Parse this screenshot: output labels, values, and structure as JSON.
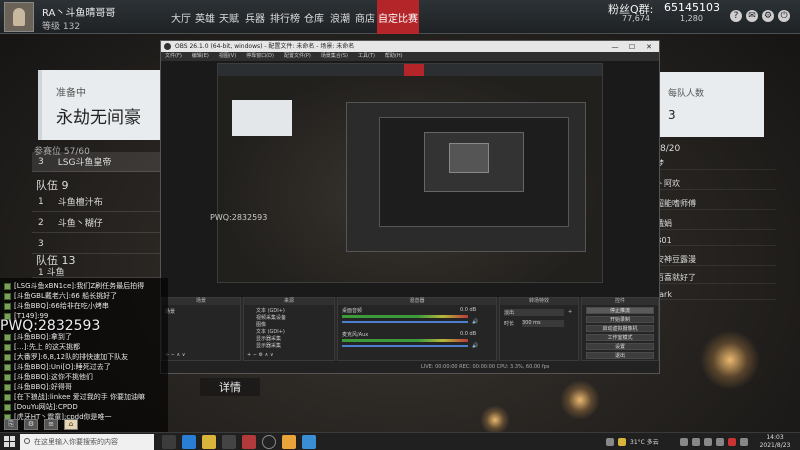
{
  "game": {
    "player_name": "RA丶斗鱼晴哥哥",
    "player_level": "等级 132",
    "nav": [
      "大厅",
      "英雄",
      "天赋",
      "兵器",
      "排行榜",
      "仓库",
      "浪潮",
      "商店",
      "自定比赛"
    ],
    "fans_label": "粉丝Q群:",
    "fans_group": "65145103",
    "coins_a": "77,674",
    "coins_b": "1,280"
  },
  "lobby": {
    "status": "准备中",
    "name": "永劫无间豪",
    "per_team_label": "每队人数",
    "per_team_value": "3",
    "seats_label": "参赛位 57/60",
    "seats_right": "8/20",
    "left_rows": [
      {
        "num": "3",
        "name": "LSG斗鱼皇帝"
      }
    ],
    "team9_label": "队伍 9",
    "team9_rows": [
      {
        "num": "1",
        "name": "斗鱼檀汁布"
      },
      {
        "num": "2",
        "name": "斗鱼丶糊仔"
      },
      {
        "num": "3",
        "name": ""
      }
    ],
    "team13_label": "队伍 13",
    "team13_row": "1  斗鱼",
    "right_entries": [
      "梦",
      "丶阿欢",
      "",
      "超能嗜师傅",
      "",
      "娥娟",
      "B01",
      "安神豆露漫",
      "百喜就好了",
      "",
      "tark"
    ],
    "detail_button": "详情"
  },
  "obs": {
    "title": "OBS 26.1.0 (64-bit, windows) - 配置文件: 未命名 - 场景: 未命名",
    "menu": [
      "文件(F)",
      "编辑(E)",
      "视图(V)",
      "停靠窗口(D)",
      "配置文件(P)",
      "场景集合(S)",
      "工具(T)",
      "帮助(H)"
    ],
    "docks": {
      "scenes": "场景",
      "sources": "来源",
      "mixer": "混音器",
      "transitions": "转场特效",
      "controls": "控件",
      "scene_item": "场景",
      "source_items": [
        "文本 (GDI+)",
        "视频采集设备",
        "图像",
        "文本 (GDI+)",
        "显示器采集",
        "显示器采集"
      ],
      "mixer_items": [
        "桌面音频",
        "麦克风/Aux"
      ],
      "mixer_db": [
        "0.0 dB",
        "0.0 dB"
      ],
      "transition_value": "淡出",
      "transition_duration_label": "时长",
      "transition_duration": "300 ms",
      "control_buttons": [
        "停止推流",
        "开始录制",
        "启动虚拟摄像机",
        "工作室模式",
        "设置",
        "退出"
      ]
    },
    "status": "LIVE: 00:00:00   REC: 00:00:00   CPU: 3.3%, 60.00 fps"
  },
  "overlay": {
    "pwq_big": "PWQ:2832593",
    "pwq_small": "PWQ:2832593"
  },
  "chat": {
    "lines": [
      "[LSG斗鱼xBN1ce]:我们Z刷任务最后拍得",
      "[斗鱼GBL戴老六]:66 船长挑好了",
      "[斗鱼BBQ]:66给非在吃小烤串",
      "[T149]:99",
      "[斗鱼BBQ]:拿到了",
      "[…]:先上 的这天挑都",
      "[大番罗]:6,8,12队的排快速加下队友",
      "[斗鱼BBQ]:Uni[O]:睡死过去了",
      "[斗鱼BBQ]:这你不挑他们",
      "[斗鱼BBQ]:好得哥",
      "[在下狼战]:linkee 爱过我的手 你要加油嘛",
      "[DouYu网站]:CPDD",
      "[虎牙HT丶震童]:cpdd你是唯一"
    ]
  },
  "taskbar": {
    "search_placeholder": "在这里输入你要搜索的内容",
    "weather": "31°C 多云",
    "time": "14:03",
    "date": "2021/8/23"
  }
}
